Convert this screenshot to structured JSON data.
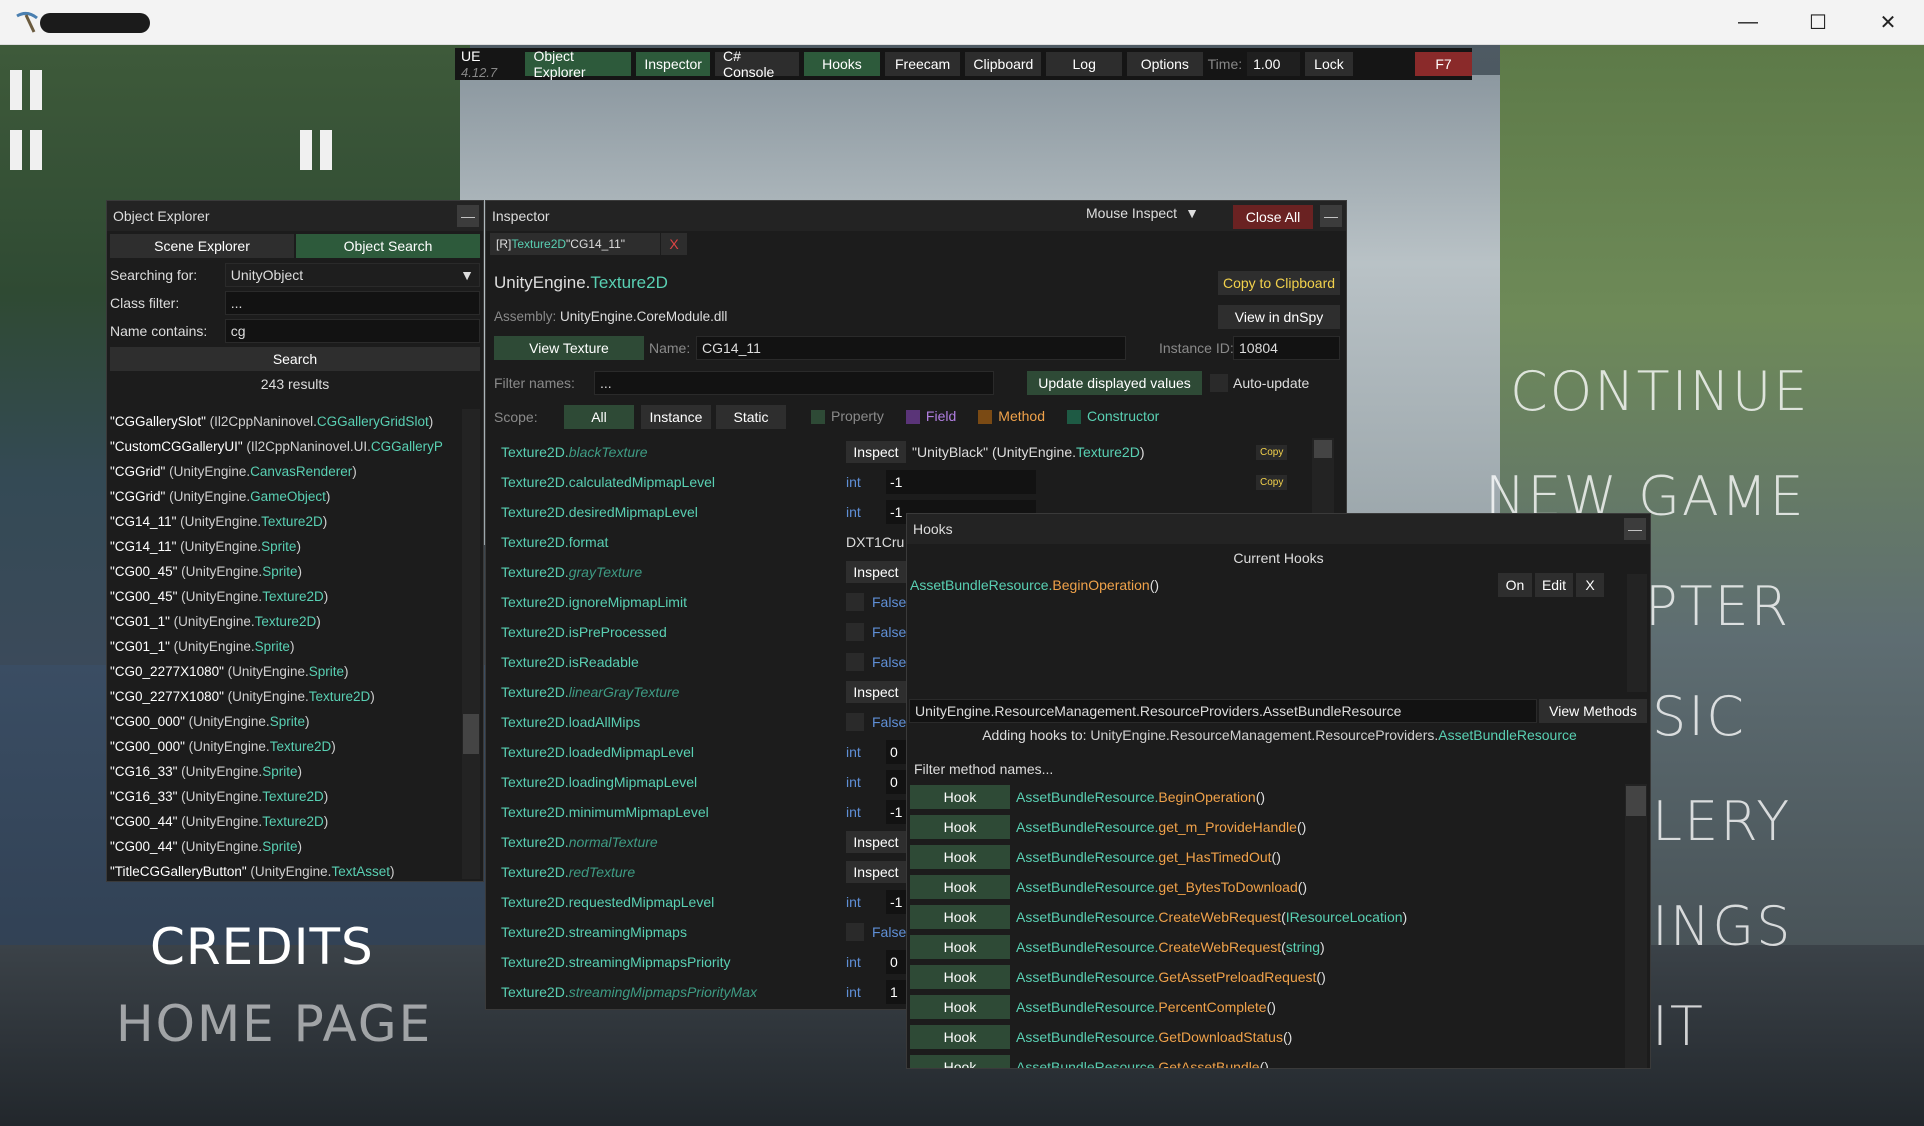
{
  "window": {
    "controls": {
      "minimize": "—",
      "maximize": "☐",
      "close": "✕"
    }
  },
  "game_menu": {
    "items": [
      "CONTINUE",
      "NEW  GAME",
      "CHAPTER",
      "MUSIC",
      "GALLERY",
      "SETTINGS",
      "EXIT"
    ],
    "visible_fragments": [
      "CONTINUE",
      "NEW  GAME",
      "PTER",
      "SIC",
      "LERY",
      "INGS",
      "IT"
    ],
    "credits": "CREDITS",
    "home_page": "HOME  PAGE"
  },
  "ue_bar": {
    "label": "UE",
    "version": "4.12.7",
    "tabs": [
      "Object Explorer",
      "Inspector",
      "C# Console",
      "Hooks",
      "Freecam",
      "Clipboard",
      "Log",
      "Options"
    ],
    "active_tabs": [
      "Object Explorer",
      "Inspector",
      "Hooks"
    ],
    "time_label": "Time:",
    "time_value": "1.00",
    "lock": "Lock",
    "hotkey": "F7"
  },
  "object_explorer": {
    "title": "Object Explorer",
    "tab_scene": "Scene Explorer",
    "tab_search": "Object Search",
    "searching_for_label": "Searching for:",
    "searching_for_value": "UnityObject",
    "class_filter_label": "Class filter:",
    "class_filter_placeholder": "...",
    "name_contains_label": "Name contains:",
    "name_contains_value": "cg",
    "search_button": "Search",
    "result_count": "243 results",
    "results": [
      {
        "name": "\"CGGallerySlot\" ",
        "ns": "(Il2CppNaninovel.",
        "type": "CGGalleryGridSlot",
        "end": ")"
      },
      {
        "name": "\"CustomCGGalleryUI\" ",
        "ns": "(Il2CppNaninovel.UI.",
        "type": "CGGalleryP",
        "end": ""
      },
      {
        "name": "\"CGGrid\" ",
        "ns": "(UnityEngine.",
        "type": "CanvasRenderer",
        "end": ")"
      },
      {
        "name": "\"CGGrid\" ",
        "ns": "(UnityEngine.",
        "type": "GameObject",
        "end": ")"
      },
      {
        "name": "\"CG14_11\" ",
        "ns": "(UnityEngine.",
        "type": "Texture2D",
        "end": ")"
      },
      {
        "name": "\"CG14_11\" ",
        "ns": "(UnityEngine.",
        "type": "Sprite",
        "end": ")"
      },
      {
        "name": "\"CG00_45\" ",
        "ns": "(UnityEngine.",
        "type": "Sprite",
        "end": ")"
      },
      {
        "name": "\"CG00_45\" ",
        "ns": "(UnityEngine.",
        "type": "Texture2D",
        "end": ")"
      },
      {
        "name": "\"CG01_1\" ",
        "ns": "(UnityEngine.",
        "type": "Texture2D",
        "end": ")"
      },
      {
        "name": "\"CG01_1\" ",
        "ns": "(UnityEngine.",
        "type": "Sprite",
        "end": ")"
      },
      {
        "name": "\"CG0_2277X1080\" ",
        "ns": "(UnityEngine.",
        "type": "Sprite",
        "end": ")"
      },
      {
        "name": "\"CG0_2277X1080\" ",
        "ns": "(UnityEngine.",
        "type": "Texture2D",
        "end": ")"
      },
      {
        "name": "\"CG00_000\" ",
        "ns": "(UnityEngine.",
        "type": "Sprite",
        "end": ")"
      },
      {
        "name": "\"CG00_000\" ",
        "ns": "(UnityEngine.",
        "type": "Texture2D",
        "end": ")"
      },
      {
        "name": "\"CG16_33\" ",
        "ns": "(UnityEngine.",
        "type": "Sprite",
        "end": ")"
      },
      {
        "name": "\"CG16_33\" ",
        "ns": "(UnityEngine.",
        "type": "Texture2D",
        "end": ")"
      },
      {
        "name": "\"CG00_44\" ",
        "ns": "(UnityEngine.",
        "type": "Texture2D",
        "end": ")"
      },
      {
        "name": "\"CG00_44\" ",
        "ns": "(UnityEngine.",
        "type": "Sprite",
        "end": ")"
      },
      {
        "name": "\"TitleCGGalleryButton\" ",
        "ns": "(UnityEngine.",
        "type": "TextAsset",
        "end": ")"
      }
    ]
  },
  "inspector": {
    "title": "Inspector",
    "mouse_inspect": "Mouse Inspect",
    "close_all": "Close All",
    "tab_prefix": "[R] ",
    "tab_type": "Texture2D",
    "tab_name": " \"CG14_11\"",
    "tab_close": "X",
    "class_ns": "UnityEngine.",
    "class_name": "Texture2D",
    "copy_clipboard": "Copy to Clipboard",
    "assembly_label": "Assembly: ",
    "assembly_value": "UnityEngine.CoreModule.dll",
    "view_dnspy": "View in dnSpy",
    "view_texture": "View Texture",
    "name_label": "Name:",
    "name_value": "CG14_11",
    "instance_id_label": "Instance ID:",
    "instance_id_value": "10804",
    "filter_label": "Filter names:",
    "filter_placeholder": "...",
    "update_values": "Update displayed values",
    "auto_update": "Auto-update",
    "scope_label": "Scope:",
    "scope_all": "All",
    "scope_instance": "Instance",
    "scope_static": "Static",
    "legend_property": "Property",
    "legend_field": "Field",
    "legend_method": "Method",
    "legend_constructor": "Constructor",
    "members": [
      {
        "owner": "Texture2D.",
        "name": "blackTexture",
        "static": true,
        "kind": "inspect",
        "value": "\"UnityBlack\" (UnityEngine.",
        "vtype": "Texture2D",
        "vend": ")",
        "copy": "Copy"
      },
      {
        "owner": "Texture2D.",
        "name": "calculatedMipmapLevel",
        "static": false,
        "kind": "int",
        "type": "int",
        "value": "-1",
        "copy": "Copy"
      },
      {
        "owner": "Texture2D.",
        "name": "desiredMipmapLevel",
        "static": false,
        "kind": "int",
        "type": "int",
        "value": "-1"
      },
      {
        "owner": "Texture2D.",
        "name": "format",
        "static": false,
        "kind": "text",
        "value": "DXT1Cru"
      },
      {
        "owner": "Texture2D.",
        "name": "grayTexture",
        "static": true,
        "kind": "inspect"
      },
      {
        "owner": "Texture2D.",
        "name": "ignoreMipmapLimit",
        "static": false,
        "kind": "bool",
        "value": "False"
      },
      {
        "owner": "Texture2D.",
        "name": "isPreProcessed",
        "static": false,
        "kind": "bool",
        "value": "False"
      },
      {
        "owner": "Texture2D.",
        "name": "isReadable",
        "static": false,
        "kind": "bool",
        "value": "False"
      },
      {
        "owner": "Texture2D.",
        "name": "linearGrayTexture",
        "static": true,
        "kind": "inspect"
      },
      {
        "owner": "Texture2D.",
        "name": "loadAllMips",
        "static": false,
        "kind": "bool",
        "value": "False"
      },
      {
        "owner": "Texture2D.",
        "name": "loadedMipmapLevel",
        "static": false,
        "kind": "int",
        "type": "int",
        "value": "0"
      },
      {
        "owner": "Texture2D.",
        "name": "loadingMipmapLevel",
        "static": false,
        "kind": "int",
        "type": "int",
        "value": "0"
      },
      {
        "owner": "Texture2D.",
        "name": "minimumMipmapLevel",
        "static": false,
        "kind": "int",
        "type": "int",
        "value": "-1"
      },
      {
        "owner": "Texture2D.",
        "name": "normalTexture",
        "static": true,
        "kind": "inspect"
      },
      {
        "owner": "Texture2D.",
        "name": "redTexture",
        "static": true,
        "kind": "inspect"
      },
      {
        "owner": "Texture2D.",
        "name": "requestedMipmapLevel",
        "static": false,
        "kind": "int",
        "type": "int",
        "value": "-1"
      },
      {
        "owner": "Texture2D.",
        "name": "streamingMipmaps",
        "static": false,
        "kind": "bool",
        "value": "False"
      },
      {
        "owner": "Texture2D.",
        "name": "streamingMipmapsPriority",
        "static": false,
        "kind": "int",
        "type": "int",
        "value": "0"
      },
      {
        "owner": "Texture2D.",
        "name": "streamingMipmapsPriorityMax",
        "static": true,
        "kind": "int",
        "type": "int",
        "value": "1"
      }
    ],
    "inspect_label": "Inspect"
  },
  "hooks": {
    "title": "Hooks",
    "current_hooks_label": "Current Hooks",
    "current": [
      {
        "cls": "AssetBundleResource.",
        "method": "BeginOperation",
        "args": "()",
        "on": "On",
        "edit": "Edit",
        "remove": "X"
      }
    ],
    "class_input": "UnityEngine.ResourceManagement.ResourceProviders.AssetBundleResource",
    "view_methods": "View Methods",
    "adding_label": "Adding hooks to: ",
    "adding_ns": "UnityEngine.ResourceManagement.ResourceProviders.",
    "adding_class": "AssetBundleResource",
    "filter_placeholder": "Filter method names...",
    "hook_label": "Hook",
    "methods": [
      {
        "cls": "AssetBundleResource.",
        "method": "BeginOperation",
        "pre": "(",
        "arg": "",
        "post": ")"
      },
      {
        "cls": "AssetBundleResource.",
        "method": "get_m_ProvideHandle",
        "pre": "(",
        "arg": "",
        "post": ")"
      },
      {
        "cls": "AssetBundleResource.",
        "method": "get_HasTimedOut",
        "pre": "(",
        "arg": "",
        "post": ")"
      },
      {
        "cls": "AssetBundleResource.",
        "method": "get_BytesToDownload",
        "pre": "(",
        "arg": "",
        "post": ")"
      },
      {
        "cls": "AssetBundleResource.",
        "method": "CreateWebRequest",
        "pre": "(",
        "arg": "IResourceLocation",
        "post": ")"
      },
      {
        "cls": "AssetBundleResource.",
        "method": "CreateWebRequest",
        "pre": "(",
        "arg": "string",
        "post": ")"
      },
      {
        "cls": "AssetBundleResource.",
        "method": "GetAssetPreloadRequest",
        "pre": "(",
        "arg": "",
        "post": ")"
      },
      {
        "cls": "AssetBundleResource.",
        "method": "PercentComplete",
        "pre": "(",
        "arg": "",
        "post": ")"
      },
      {
        "cls": "AssetBundleResource.",
        "method": "GetDownloadStatus",
        "pre": "(",
        "arg": "",
        "post": ")"
      },
      {
        "cls": "AssetBundleResource.",
        "method": "GetAssetBundle",
        "pre": "(",
        "arg": "",
        "post": ")"
      }
    ]
  },
  "colors": {
    "active_green": "#2d5a3b",
    "namespace_grey": "#ffffff",
    "type_green": "#59d0b3",
    "method_orange": "#f0a24a",
    "primitive_blue": "#5f8fd6",
    "copy_gold": "#f2d14c"
  }
}
